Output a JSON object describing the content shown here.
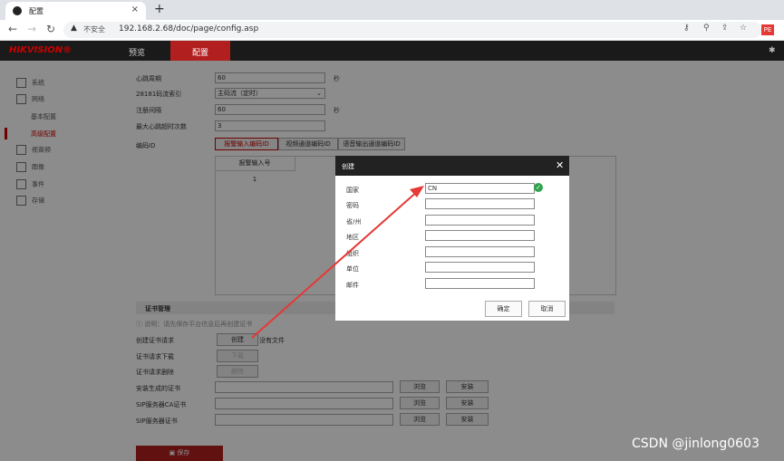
{
  "browser": {
    "tab_title": "配置",
    "tab_close": "×",
    "new_tab": "+",
    "insecure_label": "不安全",
    "url": "192.168.2.68/doc/page/config.asp"
  },
  "app": {
    "logo": "HIKVISION®",
    "nav": {
      "preview": "预览",
      "config": "配置"
    }
  },
  "sidebar": {
    "items": [
      "系统",
      "网络",
      "视音频",
      "图像",
      "事件",
      "存储"
    ],
    "network_sub": [
      "基本配置",
      "高级配置"
    ]
  },
  "form": {
    "heartbeat_label": "心跳周期",
    "heartbeat_value": "60",
    "heartbeat_unit": "秒",
    "stream_label": "28181码流索引",
    "stream_value": "主码流（定时）",
    "register_label": "注册间隔",
    "register_value": "60",
    "register_unit": "秒",
    "max_timeout_label": "最大心跳超时次数",
    "max_timeout_value": "3",
    "encode_id_label": "编码ID",
    "tabs": [
      "报警输入编码ID",
      "视频通道编码ID",
      "语音输出通道编码ID"
    ],
    "table_header": "报警输入号",
    "table_row": "1"
  },
  "cert": {
    "section_title": "证书管理",
    "hint": "说明：请先保存平台信息后再创建证书",
    "create_label": "创建证书请求",
    "create_button": "创建",
    "no_file": "没有文件",
    "download_label": "证书请求下载",
    "download_button": "下载",
    "delete_label": "证书请求删除",
    "delete_button": "删除",
    "install_label": "安装生成的证书",
    "ca_label": "SIP服务器CA证书",
    "sip_label": "SIP服务器证书",
    "browse": "浏览",
    "install": "安装",
    "save": "保存"
  },
  "dialog": {
    "title": "创建",
    "close": "✕",
    "fields": [
      {
        "label": "国家",
        "value": "CN"
      },
      {
        "label": "密码",
        "value": ""
      },
      {
        "label": "省/州",
        "value": ""
      },
      {
        "label": "地区",
        "value": ""
      },
      {
        "label": "组织",
        "value": ""
      },
      {
        "label": "单位",
        "value": ""
      },
      {
        "label": "邮件",
        "value": ""
      }
    ],
    "ok": "确定",
    "cancel": "取消"
  },
  "watermark": "CSDN @jinlong0603",
  "colors": {
    "accent": "#b21f1f",
    "arrow": "#e53935",
    "check": "#2ea44f"
  }
}
